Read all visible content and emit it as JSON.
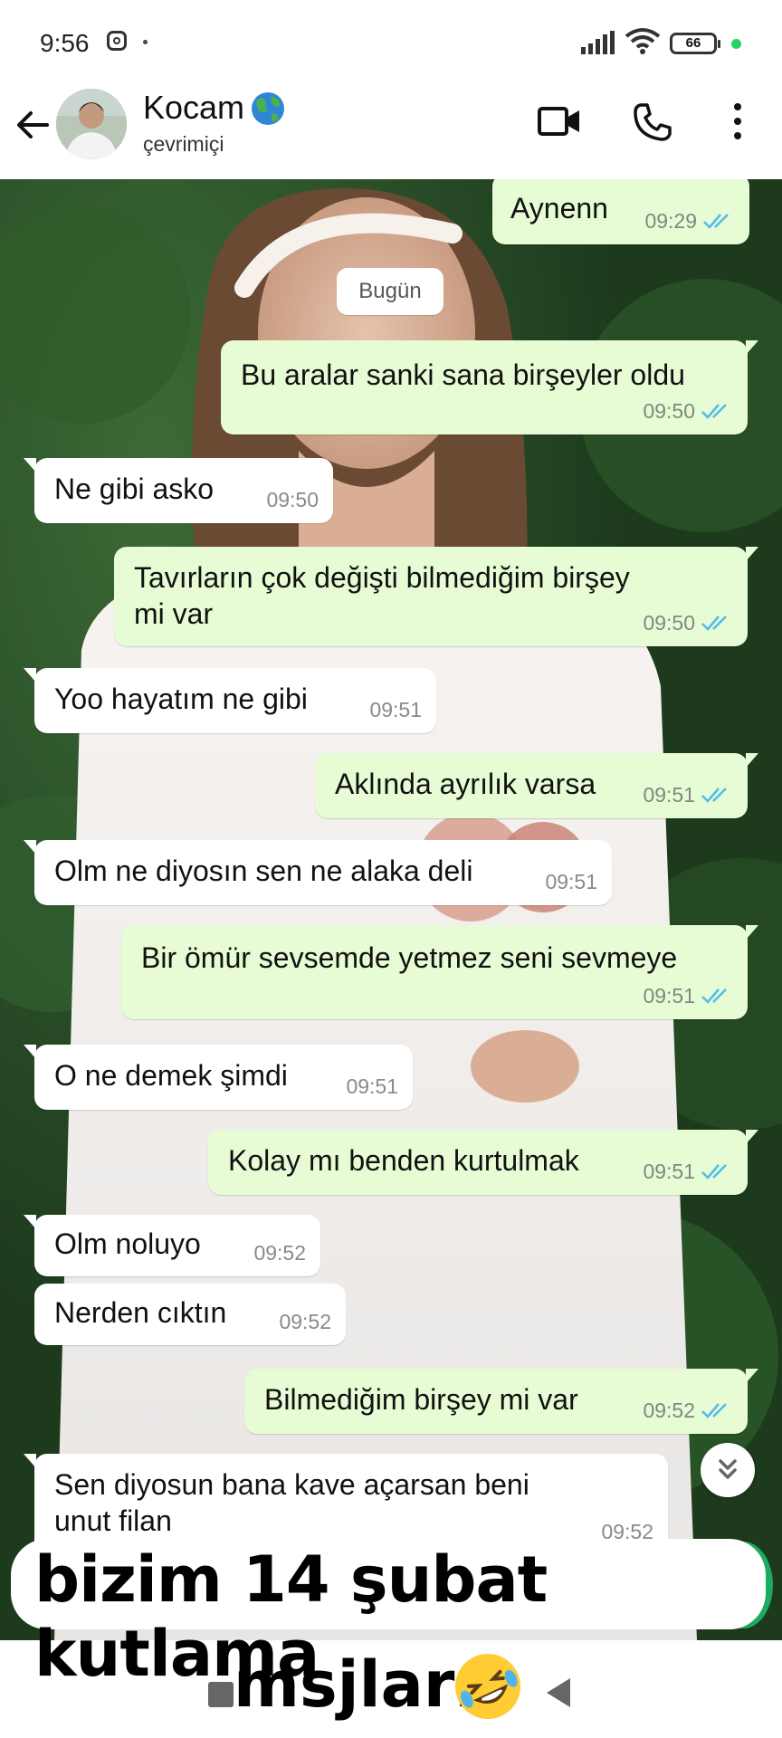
{
  "status_bar": {
    "time": "9:56",
    "battery": "66"
  },
  "header": {
    "contact_name": "Kocam",
    "status": "çevrimiçi"
  },
  "date_chip": "Bugün",
  "messages": [
    {
      "dir": "out",
      "text": "Aynenn",
      "time": "09:29"
    },
    {
      "dir": "out",
      "text": "Bu aralar sanki sana birşeyler oldu",
      "time": "09:50"
    },
    {
      "dir": "in",
      "text": "Ne gibi asko",
      "time": "09:50"
    },
    {
      "dir": "out",
      "text": "Tavırların çok değişti bilmediğim birşey mi var",
      "time": "09:50"
    },
    {
      "dir": "in",
      "text": "Yoo hayatım ne gibi",
      "time": "09:51"
    },
    {
      "dir": "out",
      "text": "Aklında ayrılık varsa",
      "time": "09:51"
    },
    {
      "dir": "in",
      "text": "Olm ne diyosın sen ne alaka deli",
      "time": "09:51"
    },
    {
      "dir": "out",
      "text": "Bir ömür sevsemde yetmez seni sevmeye",
      "time": "09:51"
    },
    {
      "dir": "in",
      "text": "O ne demek şimdi",
      "time": "09:51"
    },
    {
      "dir": "out",
      "text": "Kolay mı benden kurtulmak",
      "time": "09:51"
    },
    {
      "dir": "in",
      "text": "Olm noluyo",
      "time": "09:52"
    },
    {
      "dir": "in",
      "text": "Nerden cıktın",
      "time": "09:52"
    },
    {
      "dir": "out",
      "text": "Bilmediğim birşey mi var",
      "time": "09:52"
    },
    {
      "dir": "in",
      "text": "Sen diyosun bana kave açarsan beni unut filan",
      "time": "09:52"
    }
  ],
  "caption": {
    "line1": "bizim 14 şubat kutlama",
    "line2": "msjları"
  },
  "colors": {
    "outgoing_bubble": "#e7fcd5",
    "incoming_bubble": "#ffffff",
    "read_ticks": "#53bdeb",
    "accent": "#1daa61"
  }
}
